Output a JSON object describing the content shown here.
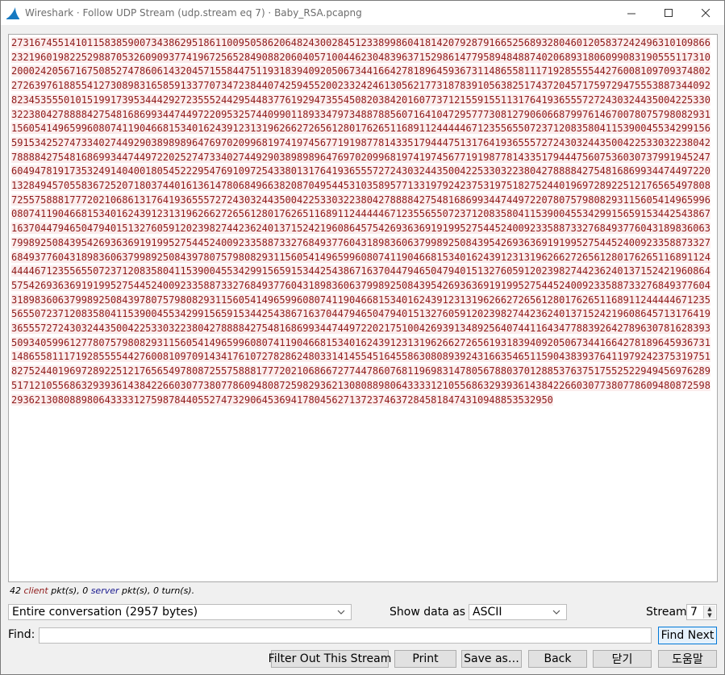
{
  "window": {
    "title": "Wireshark · Follow UDP Stream (udp.stream eq 7) · Baby_RSA.pcapng",
    "controls": {
      "minimize": "—",
      "maximize": "☐",
      "close": "✕"
    }
  },
  "stream": {
    "content": "273167455141011583859007343862951861100950586206482430028451233899860418142079287916652568932804601205837242496310109866232196019822529887053260909377419672565284908820604057100446230483963715298614779589484887402068931806099083190555117310200024205671675085274786061432045715584475119318394092050673441664278189645936731148655811171928555544276008109709374802272639761885541273089831658591337707347238440742594552002332424613056217731878391056382517437204571759729475553887344092823453555010151991739534442927235552442954483776192947355450820384201607737121559155113176419365557272430324435004225330322380427888842754816869934474497220953257440990118933479734887885607164104729577730812790606687997614670078075798082931156054149659960807411904668153401624391231319626627265612801762651168911244444671235565507237120835804115390045534299156591534252747334027449290389898964769702099681974197456771919877814335179444751317641936555727243032443500422533032238042788884275481686993447449722025274733402744929038989896476970209968197419745677191987781433517944475607536030737991945247604947819173532491404001805452229547691097254338013176419365557272430324435004225330322380427888842754816869934474497220132849457055836725207180374401613614780684966382087049544531035895771331979242375319751827524401969728922512176565497808725575888177720210686131764193655572724303244350042253303223804278888427548168699344744972207807579808293115605414965996080741190466815340162439123131962662726561280176265116891124444467123556550723712083580411539004553429915659153442543867163704479465047940151327605912023982744236240137152421960864575426936369191995275445240092335887332768493776043189836063799892508439542693636919199527544524009233588733276849377604318983606379989250843954269363691919952754452400923358873327684937760431898360637998925084397807579808293115605414965996080741190466815340162439123131962662726561280176265116891124444467123556550723712083580411539004553429915659153442543867163704479465047940151327605912023982744236240137152421960864575426936369191995275445240092335887332768493776043189836063799892508439542693636919199527544524009233588733276849377604318983606379989250843978075798082931156054149659960807411904668153401624391231319626627265612801762651168911244444671235565507237120835804115390045534299156591534425438671637044794650479401513276059120239827442362401371524219608645713176419365557272430324435004225330322380427888842754816869934474497220217510042693913489256407441164347788392642789630781628393509340599612778075798082931156054149659960807411904668153401624391231319626627265619318394092050673441664278189645936731148655811171928555544276008109709143417610727828624803314145545164558630808939243166354651159043839376411979242375319751827524401969728922512176565497808725575888177720210686672774478607681196983147805678803701288537637517552522949456976289517121055686329393614384226603077380778609480872598293621308088980643333121055686329393614384226603077380778609480872598293621308088980643333127598784405527473290645369417804562713723746372845818474310948853532950"
  },
  "stats": {
    "client_count": "42",
    "client_label": "client",
    "client_suffix": "pkt(s),",
    "server_count": "0",
    "server_label": "server",
    "server_suffix": "pkt(s),",
    "turns": "0 turn(s)."
  },
  "controls": {
    "conversation_select": "Entire conversation (2957 bytes)",
    "show_data_label": "Show data as",
    "show_data_value": "ASCII",
    "stream_label": "Stream",
    "stream_value": "7",
    "find_label": "Find:",
    "find_value": "",
    "find_next": "Find Next"
  },
  "buttons": {
    "filter_out": "Filter Out This Stream",
    "print": "Print",
    "save_as": "Save as…",
    "back": "Back",
    "close": "닫기",
    "help": "도움말"
  },
  "colors": {
    "client_text": "#8f1a1a",
    "client_bg": "#fbeded",
    "server_text": "#1a1a8f"
  }
}
